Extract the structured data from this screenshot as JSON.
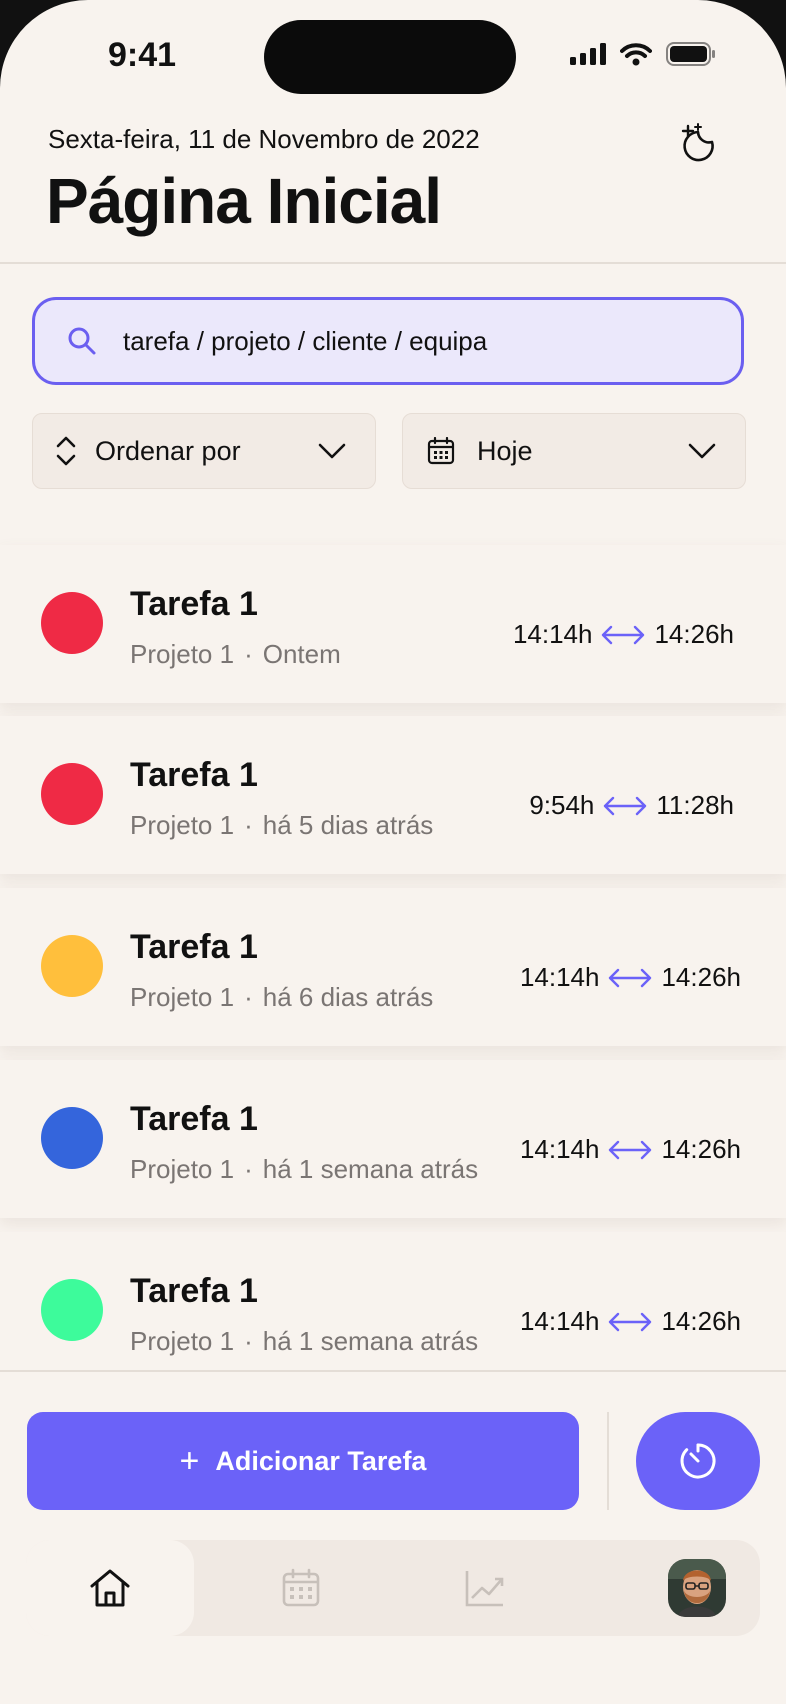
{
  "status": {
    "time": "9:41"
  },
  "header": {
    "date": "Sexta-feira, 11 de Novembro de 2022",
    "title": "Página Inicial",
    "theme_icon": "moon-stars-icon"
  },
  "search": {
    "placeholder": "tarefa / projeto / cliente / equipa"
  },
  "filters": {
    "sort_label": "Ordenar por",
    "date_label": "Hoje"
  },
  "tasks": [
    {
      "name": "Tarefa 1",
      "project": "Projeto 1",
      "when": "Ontem",
      "start": "14:14h",
      "end": "14:26h",
      "color": "#ef2a45"
    },
    {
      "name": "Tarefa 1",
      "project": "Projeto 1",
      "when": "há 5 dias atrás",
      "start": "9:54h",
      "end": "11:28h",
      "color": "#ef2a45"
    },
    {
      "name": "Tarefa 1",
      "project": "Projeto 1",
      "when": "há 6 dias atrás",
      "start": "14:14h",
      "end": "14:26h",
      "color": "#ffbf3c"
    },
    {
      "name": "Tarefa 1",
      "project": "Projeto 1",
      "when": "há 1 semana atrás",
      "start": "14:14h",
      "end": "14:26h",
      "color": "#3465dc"
    },
    {
      "name": "Tarefa 1",
      "project": "Projeto 1",
      "when": "há 1 semana atrás",
      "start": "14:14h",
      "end": "14:26h",
      "color": "#3dfb9b"
    }
  ],
  "actions": {
    "add_task": "Adicionar Tarefa",
    "timer_icon": "timer-icon"
  },
  "tabbar": {
    "active": "home",
    "items": [
      "home-icon",
      "calendar-icon",
      "chart-icon",
      "avatar"
    ]
  },
  "colors": {
    "accent": "#6b62f8",
    "background": "#f8f3ee",
    "search_bg": "#ebe8fb"
  }
}
